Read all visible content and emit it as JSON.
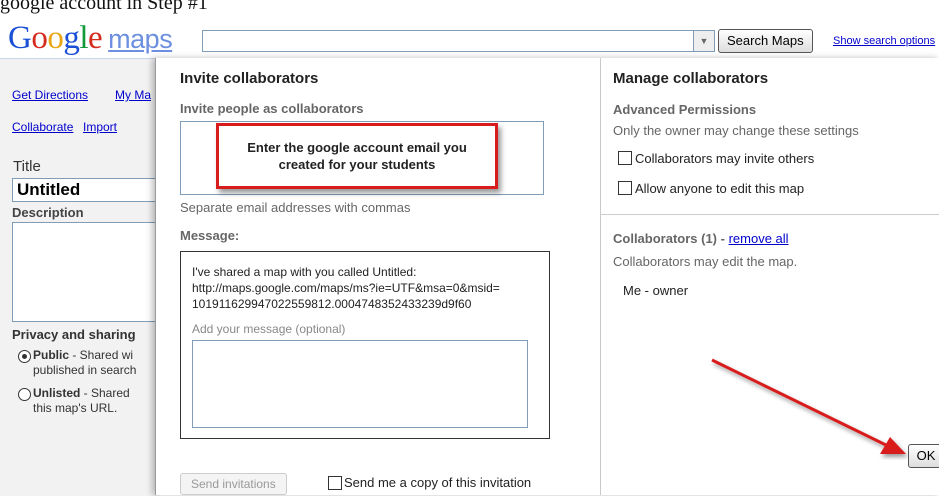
{
  "caption": "google account in Step #1",
  "header": {
    "logo_word": "Google",
    "logo_product": "maps",
    "search_value": "",
    "search_button": "Search Maps",
    "search_options": "Show search options"
  },
  "left_panel": {
    "get_directions": "Get Directions",
    "my_maps": "My Ma",
    "collaborate": "Collaborate",
    "import": "Import",
    "title_label": "Title",
    "title_value": "Untitled",
    "description_label": "Description",
    "privacy_heading": "Privacy and sharing",
    "public_label": "Public",
    "public_text": " - Shared wi",
    "public_text2": "published in search",
    "unlisted_label": "Unlisted",
    "unlisted_text": " - Shared",
    "unlisted_text2": "this map's URL.",
    "privacy_selected": "Public"
  },
  "invite": {
    "title": "Invite collaborators",
    "subtitle": "Invite people as collaborators",
    "callout_line1": "Enter the google account email you",
    "callout_line2": "created for your students",
    "separate_hint": "Separate email addresses with commas",
    "message_label": "Message:",
    "message_line1": "I've shared a map with you called Untitled:",
    "message_line2": "http://maps.google.com/maps/ms?ie=UTF&msa=0&msid=",
    "message_line3": "101911629947022559812.00047483524332​39d9f60",
    "message_placeholder": "Add your message (optional)",
    "send_button": "Send invitations",
    "copy_label": "Send me a copy of this invitation"
  },
  "manage": {
    "title": "Manage collaborators",
    "advanced_permissions": "Advanced Permissions",
    "owner_note": "Only the owner may change these settings",
    "invite_others_label": "Collaborators may invite others",
    "anyone_edit_label": "Allow anyone to edit this map",
    "collaborators_count": "Collaborators (1) - ",
    "remove_all": "remove all",
    "collab_note": "Collaborators may edit the map.",
    "owner_line": "Me - owner",
    "ok_button": "OK"
  },
  "colors": {
    "callout_border": "#d81b1b",
    "link": "#0000cc",
    "arrow": "#d81b1b"
  }
}
